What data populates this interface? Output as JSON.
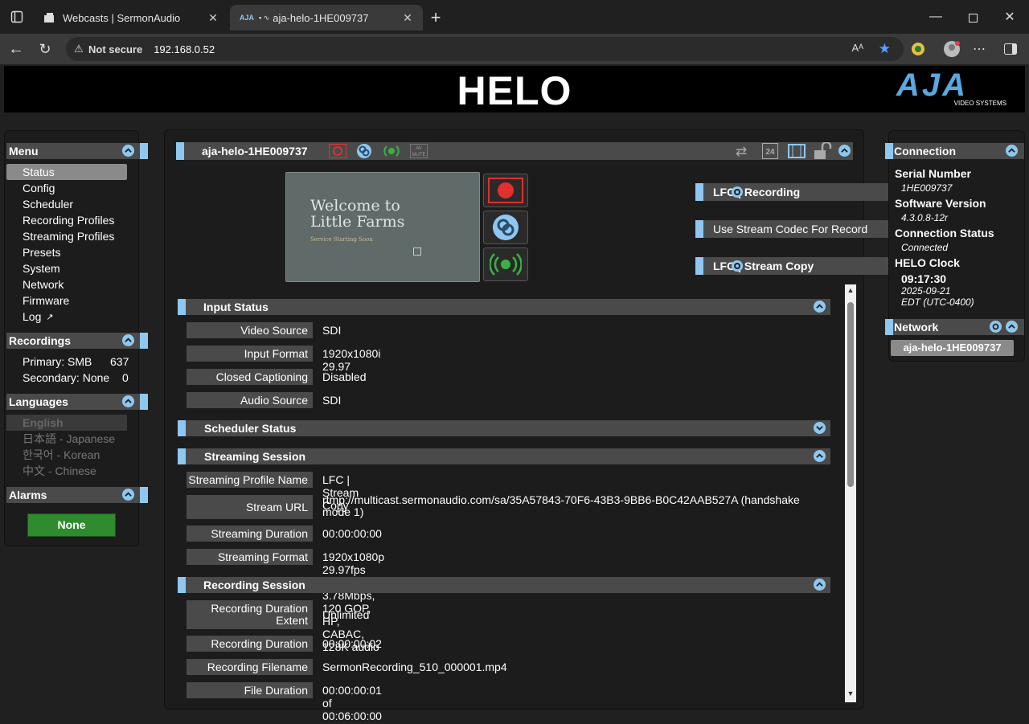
{
  "browser": {
    "tabs": [
      {
        "title": "Webcasts | SermonAudio"
      },
      {
        "title": "aja-helo-1HE009737",
        "favicon_text": "AJA"
      }
    ],
    "security": "Not secure",
    "url": "192.168.0.52"
  },
  "header": {
    "title": "HELO",
    "logo": "AJA",
    "logo_sub": "VIDEO SYSTEMS"
  },
  "menu": {
    "title": "Menu",
    "items": [
      "Status",
      "Config",
      "Scheduler",
      "Recording Profiles",
      "Streaming Profiles",
      "Presets",
      "System",
      "Network",
      "Firmware",
      "Log"
    ],
    "selected": "Status"
  },
  "recordings": {
    "title": "Recordings",
    "primary_label": "Primary: SMB",
    "primary_value": "637",
    "secondary_label": "Secondary: None",
    "secondary_value": "0"
  },
  "languages": {
    "title": "Languages",
    "items": [
      "English",
      "日本語 - Japanese",
      "한국어 - Korean",
      "中文 - Chinese"
    ]
  },
  "alarms": {
    "title": "Alarms",
    "value": "None"
  },
  "device": {
    "name": "aja-helo-1HE009737",
    "preview_title_1": "Welcome to",
    "preview_title_2": "Little Farms",
    "preview_sub": "Service Starting Soon",
    "record_profile": "LFC | Recording",
    "codec_label": "Use Stream Codec For Record",
    "stream_profile": "LFC | Stream Copy",
    "av_mute": "AV\nMUTE"
  },
  "input_status": {
    "title": "Input Status",
    "rows": [
      {
        "label": "Video Source",
        "value": "SDI"
      },
      {
        "label": "Input Format",
        "value": "1920x1080i 29.97"
      },
      {
        "label": "Closed Captioning",
        "value": "Disabled"
      },
      {
        "label": "Audio Source",
        "value": "SDI"
      }
    ]
  },
  "scheduler_status": {
    "title": "Scheduler Status"
  },
  "streaming_session": {
    "title": "Streaming Session",
    "rows": [
      {
        "label": "Streaming Profile Name",
        "value": "LFC | Stream Copy"
      },
      {
        "label": "Stream URL",
        "value": "rtmp://multicast.sermonaudio.com/sa/35A57843-70F6-43B3-9BB6-B0C42AAB527A (handshake mode 1)"
      },
      {
        "label": "Streaming Duration",
        "value": "00:00:00:00"
      },
      {
        "label": "Streaming Format",
        "value": "1920x1080p 29.97fps H.264 @ 3.78Mbps, 120 GOP, HP, CABAC, 128K audio"
      }
    ]
  },
  "recording_session": {
    "title": "Recording Session",
    "rows": [
      {
        "label": "Recording Duration Extent",
        "value": "Unlimited"
      },
      {
        "label": "Recording Duration",
        "value": "00:00:00:02"
      },
      {
        "label": "Recording Filename",
        "value": "SermonRecording_510_000001.mp4"
      },
      {
        "label": "File Duration",
        "value": "00:00:00:01 of 00:06:00:00"
      }
    ]
  },
  "connection": {
    "title": "Connection",
    "serial_label": "Serial Number",
    "serial_value": "1HE009737",
    "sw_label": "Software Version",
    "sw_value": "4.3.0.8-12r",
    "conn_label": "Connection Status",
    "conn_value": "Connected",
    "clock_label": "HELO Clock",
    "clock_time": "09:17:30",
    "clock_date": "2025-09-21",
    "clock_tz": "EDT (UTC-0400)"
  },
  "network": {
    "title": "Network",
    "device": "aja-helo-1HE009737"
  },
  "colors": {
    "accent": "#8ec8f0",
    "record_red": "#e03030",
    "stream_green": "#3cb043",
    "alarm_green": "#2e8b2e"
  }
}
